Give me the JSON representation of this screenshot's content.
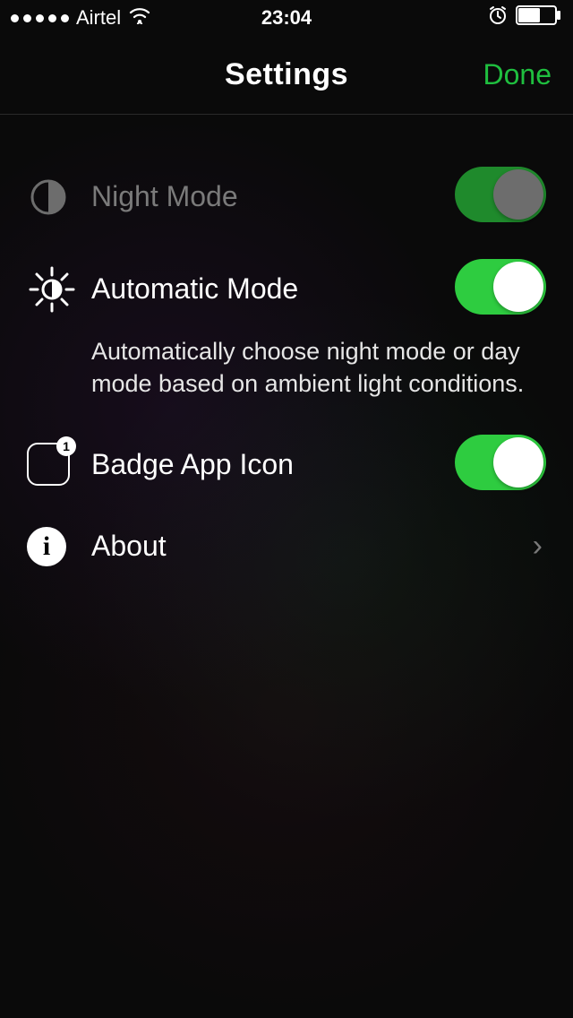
{
  "status_bar": {
    "carrier": "Airtel",
    "time": "23:04"
  },
  "nav": {
    "title": "Settings",
    "done": "Done"
  },
  "rows": {
    "night_mode": {
      "label": "Night Mode",
      "on": true
    },
    "auto_mode": {
      "label": "Automatic Mode",
      "on": true,
      "description": "Automatically choose night mode or day mode based on ambient light conditions."
    },
    "badge": {
      "label": "Badge App Icon",
      "on": true,
      "badge_count": "1"
    },
    "about": {
      "label": "About"
    }
  },
  "colors": {
    "accent": "#1fbf3f",
    "toggle_on": "#2ecc40"
  }
}
